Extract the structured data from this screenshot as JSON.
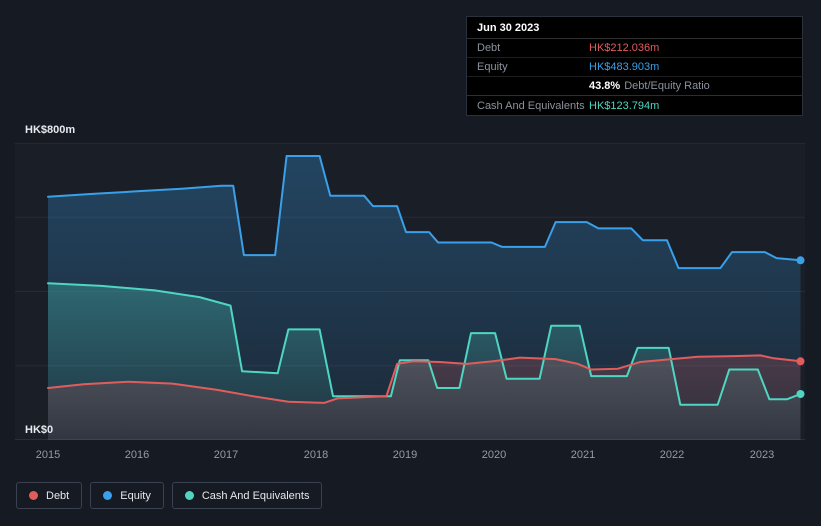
{
  "colors": {
    "debt": "#e15d5d",
    "equity": "#3aa0e9",
    "cash": "#4fd6c2",
    "grid": "#242b39",
    "grid_top": "#2a3140",
    "grid_strong": "#3a4250",
    "background": "#151a23",
    "tooltip_background": "#000000",
    "tooltip_border": "#2b313c"
  },
  "tooltip": {
    "date": "Jun 30 2023",
    "debt_label": "Debt",
    "debt_value": "HK$212.036m",
    "equity_label": "Equity",
    "equity_value": "HK$483.903m",
    "ratio_value": "43.8%",
    "ratio_label": "Debt/Equity Ratio",
    "cash_label": "Cash And Equivalents",
    "cash_value": "HK$123.794m"
  },
  "chart": {
    "y_axis_top": "HK$800m",
    "y_axis_bottom": "HK$0",
    "x_labels": [
      "2015",
      "2016",
      "2017",
      "2018",
      "2019",
      "2020",
      "2021",
      "2022",
      "2023"
    ]
  },
  "legend": {
    "debt": "Debt",
    "equity": "Equity",
    "cash": "Cash And Equivalents"
  },
  "chart_data": {
    "type": "area",
    "unit": "HK$m",
    "x_domain": [
      2014.63,
      2023.5
    ],
    "y_domain": [
      0,
      800
    ],
    "grid_values": [
      0,
      200,
      400,
      600,
      800
    ],
    "x_tick_labels": [
      "2015",
      "2016",
      "2017",
      "2018",
      "2019",
      "2020",
      "2021",
      "2022",
      "2023"
    ],
    "y_tick_labels": [
      "HK$0",
      "HK$800m"
    ],
    "latest": {
      "date": "Jun 30 2023",
      "debt": 212.036,
      "equity": 483.903,
      "debt_to_equity_ratio_pct": 43.8,
      "cash_and_equivalents": 123.794
    },
    "series": [
      {
        "key": "equity",
        "name": "Equity",
        "fill_top": 0.3,
        "fill_bottom": 0.08,
        "points": [
          [
            2015.0,
            655
          ],
          [
            2015.5,
            663
          ],
          [
            2016.0,
            670
          ],
          [
            2016.5,
            677
          ],
          [
            2016.95,
            685
          ],
          [
            2017.08,
            685
          ],
          [
            2017.2,
            498
          ],
          [
            2017.55,
            498
          ],
          [
            2017.68,
            765
          ],
          [
            2018.05,
            765
          ],
          [
            2018.17,
            658
          ],
          [
            2018.55,
            658
          ],
          [
            2018.65,
            630
          ],
          [
            2018.92,
            630
          ],
          [
            2019.02,
            560
          ],
          [
            2019.28,
            560
          ],
          [
            2019.38,
            532
          ],
          [
            2019.98,
            532
          ],
          [
            2020.1,
            520
          ],
          [
            2020.58,
            520
          ],
          [
            2020.7,
            587
          ],
          [
            2021.05,
            587
          ],
          [
            2021.18,
            570
          ],
          [
            2021.55,
            570
          ],
          [
            2021.68,
            538
          ],
          [
            2021.95,
            538
          ],
          [
            2022.08,
            463
          ],
          [
            2022.55,
            463
          ],
          [
            2022.68,
            506
          ],
          [
            2023.05,
            506
          ],
          [
            2023.18,
            490
          ],
          [
            2023.45,
            484
          ]
        ]
      },
      {
        "key": "cash",
        "name": "Cash And Equivalents",
        "fill_top": 0.3,
        "fill_bottom": 0.05,
        "points": [
          [
            2015.0,
            422
          ],
          [
            2015.6,
            415
          ],
          [
            2016.2,
            403
          ],
          [
            2016.7,
            385
          ],
          [
            2017.05,
            362
          ],
          [
            2017.18,
            185
          ],
          [
            2017.58,
            180
          ],
          [
            2017.7,
            298
          ],
          [
            2018.05,
            298
          ],
          [
            2018.2,
            118
          ],
          [
            2018.85,
            118
          ],
          [
            2018.95,
            215
          ],
          [
            2019.27,
            215
          ],
          [
            2019.37,
            140
          ],
          [
            2019.62,
            140
          ],
          [
            2019.75,
            288
          ],
          [
            2020.02,
            288
          ],
          [
            2020.15,
            165
          ],
          [
            2020.52,
            165
          ],
          [
            2020.65,
            308
          ],
          [
            2020.97,
            308
          ],
          [
            2021.1,
            172
          ],
          [
            2021.5,
            172
          ],
          [
            2021.62,
            248
          ],
          [
            2021.97,
            248
          ],
          [
            2022.1,
            95
          ],
          [
            2022.52,
            95
          ],
          [
            2022.65,
            190
          ],
          [
            2022.97,
            190
          ],
          [
            2023.1,
            110
          ],
          [
            2023.3,
            110
          ],
          [
            2023.45,
            124
          ]
        ]
      },
      {
        "key": "debt",
        "name": "Debt",
        "fill_top": 0.22,
        "fill_bottom": 0.1,
        "points": [
          [
            2015.0,
            140
          ],
          [
            2015.4,
            150
          ],
          [
            2015.9,
            157
          ],
          [
            2016.4,
            152
          ],
          [
            2016.9,
            135
          ],
          [
            2017.3,
            118
          ],
          [
            2017.7,
            103
          ],
          [
            2018.1,
            100
          ],
          [
            2018.25,
            112
          ],
          [
            2018.8,
            118
          ],
          [
            2018.92,
            205
          ],
          [
            2019.1,
            212
          ],
          [
            2019.4,
            210
          ],
          [
            2019.7,
            205
          ],
          [
            2020.0,
            212
          ],
          [
            2020.3,
            222
          ],
          [
            2020.7,
            218
          ],
          [
            2020.95,
            205
          ],
          [
            2021.1,
            190
          ],
          [
            2021.4,
            192
          ],
          [
            2021.65,
            210
          ],
          [
            2022.0,
            218
          ],
          [
            2022.3,
            224
          ],
          [
            2022.7,
            226
          ],
          [
            2023.0,
            228
          ],
          [
            2023.15,
            220
          ],
          [
            2023.45,
            212
          ]
        ]
      }
    ]
  }
}
